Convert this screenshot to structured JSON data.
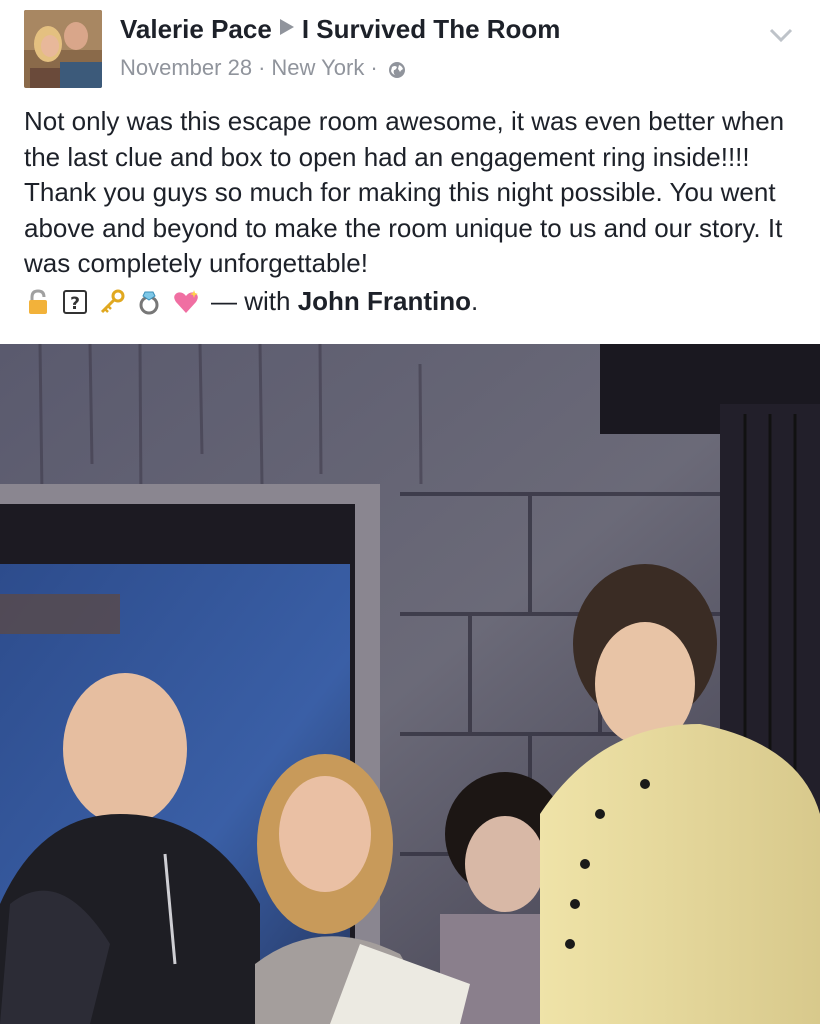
{
  "header": {
    "author": "Valerie Pace",
    "separator_icon": "right-triangle-arrow",
    "page": "I Survived The Room",
    "date": "November 28",
    "location": "New York",
    "privacy_icon": "globe-icon",
    "menu_icon": "chevron-down-icon"
  },
  "post": {
    "text": "Not only was this escape room awesome, it was even better when the last clue and box to open had an engagement ring inside!!!! Thank you guys so much for making this night possible. You went above and beyond to make the room unique to us and our story. It was completely unforgettable!",
    "emojis": [
      "lock-emoji",
      "question-box-emoji",
      "key-emoji",
      "ring-emoji",
      "sparkling-heart-emoji"
    ],
    "with_prefix": "— with",
    "tagged_person": "John Frantino",
    "with_suffix": "."
  },
  "colors": {
    "text": "#1d2129",
    "meta": "#90949c",
    "background": "#ffffff"
  }
}
